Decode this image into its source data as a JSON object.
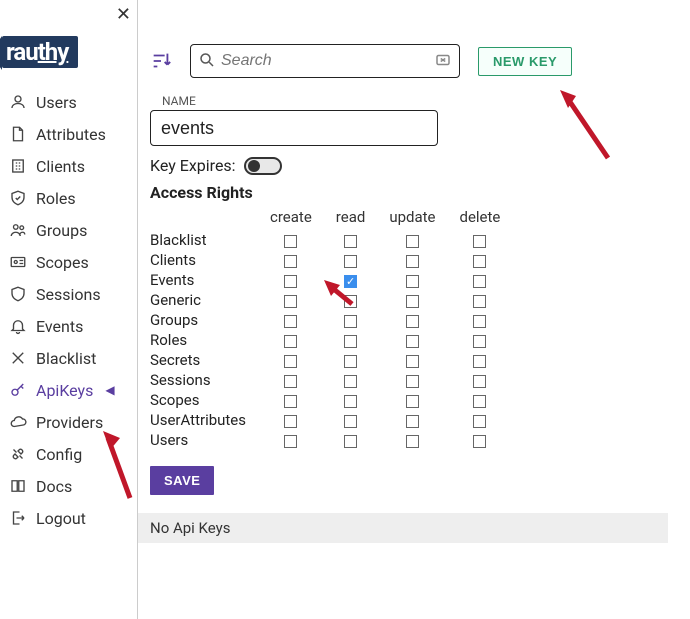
{
  "app": {
    "name": "rauthy"
  },
  "sidebar": {
    "close": "✕",
    "items": [
      {
        "label": "Users",
        "icon": "user-icon"
      },
      {
        "label": "Attributes",
        "icon": "file-icon"
      },
      {
        "label": "Clients",
        "icon": "building-icon"
      },
      {
        "label": "Roles",
        "icon": "shield-check-icon"
      },
      {
        "label": "Groups",
        "icon": "users-icon"
      },
      {
        "label": "Scopes",
        "icon": "id-card-icon"
      },
      {
        "label": "Sessions",
        "icon": "shield-icon"
      },
      {
        "label": "Events",
        "icon": "bell-icon"
      },
      {
        "label": "Blacklist",
        "icon": "x-icon"
      },
      {
        "label": "ApiKeys",
        "icon": "key-icon",
        "active": true
      },
      {
        "label": "Providers",
        "icon": "cloud-icon"
      },
      {
        "label": "Config",
        "icon": "tools-icon"
      },
      {
        "label": "Docs",
        "icon": "book-icon"
      },
      {
        "label": "Logout",
        "icon": "logout-icon"
      }
    ]
  },
  "toolbar": {
    "search_placeholder": "Search",
    "new_key_label": "NEW KEY"
  },
  "form": {
    "name_label": "NAME",
    "name_value": "events",
    "key_expires_label": "Key Expires:",
    "key_expires": false,
    "access_rights_title": "Access Rights",
    "columns": [
      "create",
      "read",
      "update",
      "delete"
    ],
    "rows": [
      {
        "label": "Blacklist",
        "perms": [
          false,
          false,
          false,
          false
        ]
      },
      {
        "label": "Clients",
        "perms": [
          false,
          false,
          false,
          false
        ]
      },
      {
        "label": "Events",
        "perms": [
          false,
          true,
          false,
          false
        ]
      },
      {
        "label": "Generic",
        "perms": [
          false,
          false,
          false,
          false
        ]
      },
      {
        "label": "Groups",
        "perms": [
          false,
          false,
          false,
          false
        ]
      },
      {
        "label": "Roles",
        "perms": [
          false,
          false,
          false,
          false
        ]
      },
      {
        "label": "Secrets",
        "perms": [
          false,
          false,
          false,
          false
        ]
      },
      {
        "label": "Sessions",
        "perms": [
          false,
          false,
          false,
          false
        ]
      },
      {
        "label": "Scopes",
        "perms": [
          false,
          false,
          false,
          false
        ]
      },
      {
        "label": "UserAttributes",
        "perms": [
          false,
          false,
          false,
          false
        ]
      },
      {
        "label": "Users",
        "perms": [
          false,
          false,
          false,
          false
        ]
      }
    ],
    "save_label": "SAVE"
  },
  "footer": {
    "no_keys": "No Api Keys"
  },
  "annotations": {
    "arrow_newkey": true,
    "arrow_apikeys": true,
    "arrow_events_read": true
  },
  "colors": {
    "accent": "#5a3ea0",
    "success": "#2a9a6a",
    "checkbox_checked": "#3a8eed",
    "arrow": "#c0172a",
    "logo_bg": "#223a5e"
  }
}
